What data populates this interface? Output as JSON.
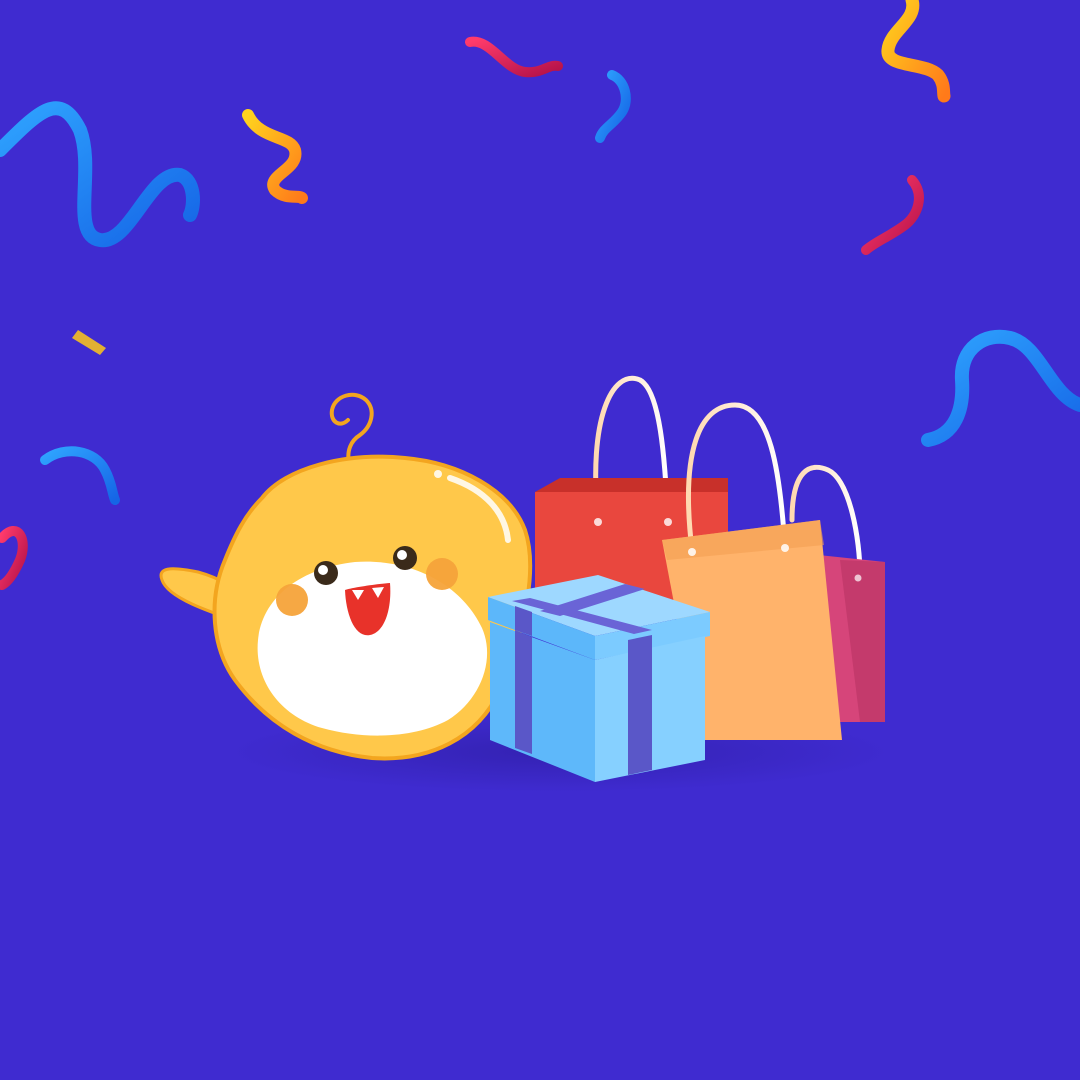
{
  "scene": {
    "background_color": "#3F2BD0",
    "mascot": {
      "name": "yellow-mascot",
      "body_color": "#FFC84A",
      "outline_color": "#F3A51F",
      "belly_color": "#FFFFFF",
      "cheek_color": "#F6A33A",
      "mouth_color": "#E8322A",
      "expression": "happy-waving"
    },
    "gift_box": {
      "color": "#6EC4FF",
      "ribbon_color": "#5A57C8"
    },
    "shopping_bags": [
      {
        "name": "red-shopping-bag",
        "color": "#E9473E"
      },
      {
        "name": "orange-shopping-bag",
        "color": "#FFB36B"
      },
      {
        "name": "pink-shopping-bag",
        "color": "#D6457A"
      }
    ],
    "confetti_colors": [
      "#1E8CF0",
      "#FFC31E",
      "#FF7A1A",
      "#E8235A",
      "#C2185B"
    ]
  }
}
